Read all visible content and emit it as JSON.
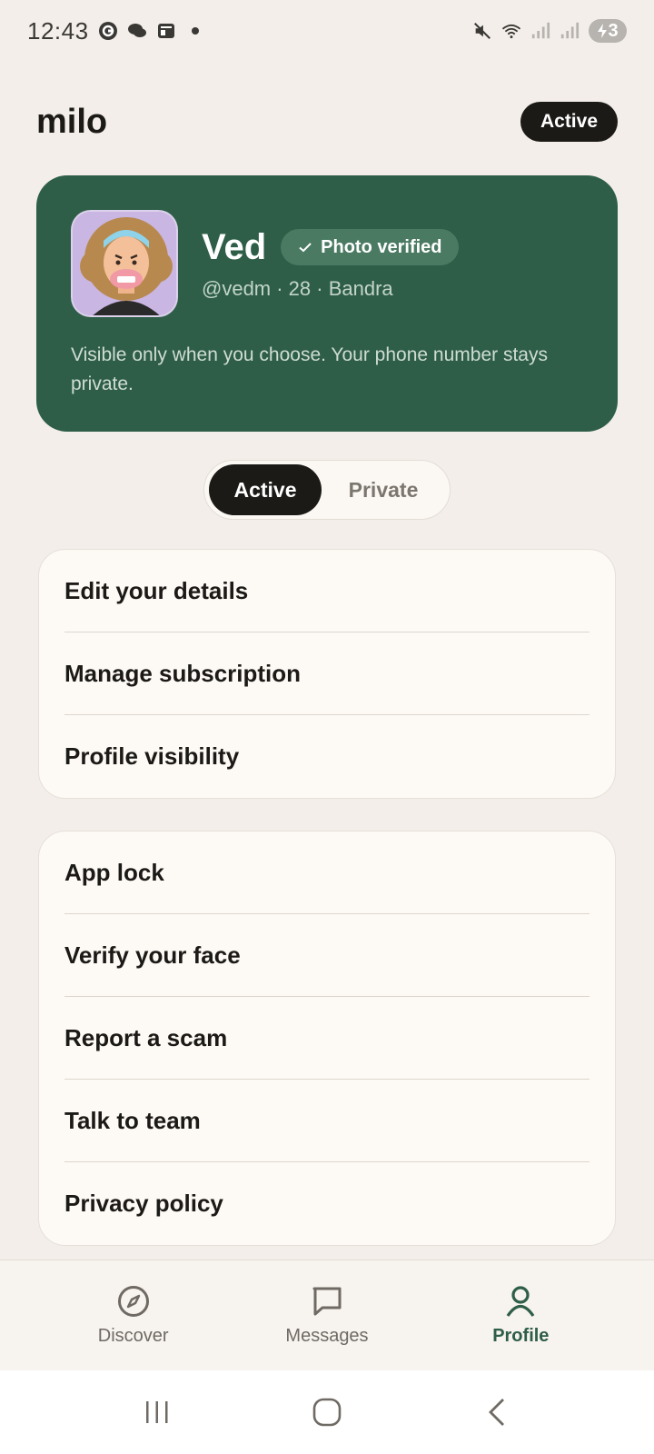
{
  "status_bar": {
    "time": "12:43",
    "battery": "3"
  },
  "header": {
    "app_name": "milo",
    "status_pill": "Active"
  },
  "profile": {
    "name": "Ved",
    "verified_label": "Photo verified",
    "meta": "@vedm · 28 · Bandra",
    "note": "Visible only when you choose. Your phone number stays private."
  },
  "visibility_toggle": {
    "options": [
      "Active",
      "Private"
    ],
    "selected": "Active"
  },
  "menu_group_1": [
    {
      "label": "Edit your details"
    },
    {
      "label": "Manage subscription"
    },
    {
      "label": "Profile visibility"
    }
  ],
  "menu_group_2": [
    {
      "label": "App lock"
    },
    {
      "label": "Verify your face"
    },
    {
      "label": "Report a scam"
    },
    {
      "label": "Talk to team"
    },
    {
      "label": "Privacy policy"
    }
  ],
  "bottom_nav": {
    "items": [
      {
        "label": "Discover",
        "icon": "compass-icon"
      },
      {
        "label": "Messages",
        "icon": "chat-icon"
      },
      {
        "label": "Profile",
        "icon": "person-icon"
      }
    ],
    "active": "Profile"
  },
  "colors": {
    "background": "#f3eee9",
    "card_green": "#2e5e48",
    "accent": "#2e5e48",
    "dark": "#1c1a17"
  }
}
